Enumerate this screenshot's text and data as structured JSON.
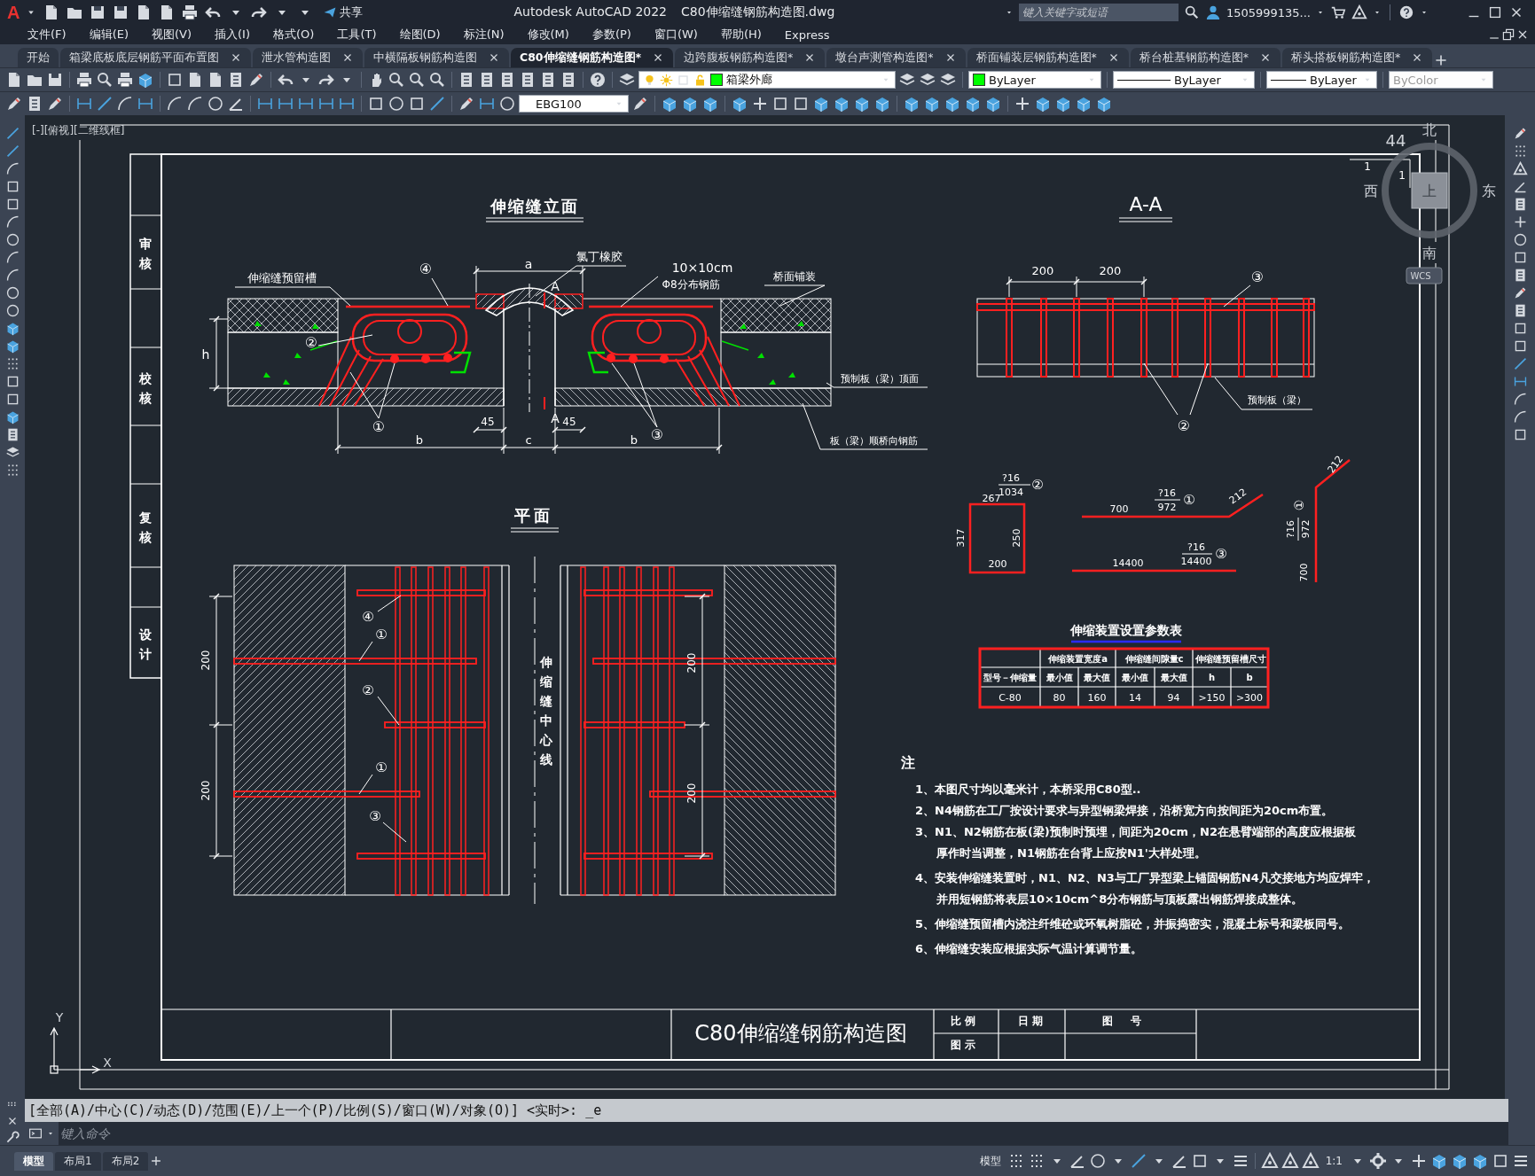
{
  "title_bar": {
    "logo": "A",
    "share": "共享",
    "app": "Autodesk AutoCAD 2022",
    "file": "C80伸缩缝钢筋构造图.dwg",
    "search": {
      "placeholder": "键入关键字或短语"
    },
    "user": "1505999135..."
  },
  "menu": [
    "文件(F)",
    "编辑(E)",
    "视图(V)",
    "插入(I)",
    "格式(O)",
    "工具(T)",
    "绘图(D)",
    "标注(N)",
    "修改(M)",
    "参数(P)",
    "窗口(W)",
    "帮助(H)",
    "Express"
  ],
  "file_tabs": [
    {
      "label": "开始",
      "selected": false,
      "closable": false
    },
    {
      "label": "箱梁底板底层钢筋平面布置图",
      "selected": false,
      "closable": true
    },
    {
      "label": "泄水管构造图",
      "selected": false,
      "closable": true
    },
    {
      "label": "中横隔板钢筋构造图",
      "selected": false,
      "closable": true
    },
    {
      "label": "C80伸缩缝钢筋构造图*",
      "selected": true,
      "closable": true
    },
    {
      "label": "边跨腹板钢筋构造图*",
      "selected": false,
      "closable": true
    },
    {
      "label": "墩台声测管构造图*",
      "selected": false,
      "closable": true
    },
    {
      "label": "桥面铺装层钢筋构造图*",
      "selected": false,
      "closable": true
    },
    {
      "label": "桥台桩基钢筋构造图*",
      "selected": false,
      "closable": true
    },
    {
      "label": "桥头搭板钢筋构造图*",
      "selected": false,
      "closable": true
    }
  ],
  "properties": {
    "layer": {
      "name": "箱梁外廊",
      "color": "#00ff00"
    },
    "color": {
      "value": "ByLayer",
      "color": "#00ff00"
    },
    "linetype": "ByLayer",
    "lineweight": "ByLayer",
    "plot_style": {
      "value": "ByColor",
      "disabled": true
    },
    "dim_style": "EBG100"
  },
  "viewport_label": "[-][俯视][二维线框]",
  "drawing": {
    "sign_labels": [
      "审核",
      "校核",
      "复核",
      "设计"
    ],
    "elevation": {
      "title": "伸缩缝立面",
      "labels": [
        "伸缩缝预留槽",
        "④",
        "a",
        "氯丁橡胶",
        "10×10cm",
        "Φ8分布钢筋",
        "桥面铺装",
        "A",
        "A",
        "h",
        "②",
        "①",
        "45",
        "45",
        "b",
        "c",
        "b",
        "③",
        "预制板（梁）顶面",
        "板（梁）顺桥向钢筋"
      ]
    },
    "section": {
      "title": "A-A",
      "labels": [
        "200",
        "200",
        "③",
        "②",
        "预制板（梁）"
      ]
    },
    "rebar_details": [
      {
        "labels": [
          "?16",
          "1034",
          "②",
          "267",
          "317",
          "250",
          "200"
        ]
      },
      {
        "labels": [
          "700",
          "?16",
          "972",
          "①",
          "212"
        ]
      },
      {
        "labels": [
          "14400",
          "?16",
          "14400",
          "③"
        ]
      },
      {
        "labels": [
          "212",
          "?16",
          "①",
          "972",
          "700"
        ]
      }
    ],
    "plan": {
      "title": "平面",
      "labels": [
        "④",
        "①",
        "②",
        "①",
        "③",
        "200",
        "200",
        "200",
        "200"
      ],
      "centerline": "伸缩缝中心线"
    },
    "table": {
      "title": "伸缩装置设置参数表",
      "header": [
        "型号－伸缩量",
        "伸缩装置宽度a",
        "伸缩缝间隙量c",
        "伸缩缝预留槽尺寸"
      ],
      "subheader": [
        "最小值",
        "最大值",
        "最小值",
        "最大值",
        "h",
        "b"
      ],
      "rows": [
        [
          "C-80",
          "80",
          "160",
          "14",
          "94",
          ">150",
          ">300"
        ]
      ]
    },
    "notes": {
      "heading": "注",
      "items": [
        {
          "lines": [
            "1、本图尺寸均以毫米计，本桥采用C80型.."
          ]
        },
        {
          "lines": [
            "2、N4钢筋在工厂按设计要求与异型钢梁焊接，沿桥宽方向按间距为20cm布置。"
          ]
        },
        {
          "lines": [
            "3、N1、N2钢筋在板(梁)预制时预埋，间距为20cm，N2在悬臂端部的高度应根据板",
            "厚作时当调整，N1钢筋在台背上应按N1'大样处理。"
          ]
        },
        {
          "lines": [
            "4、安装伸缩缝装置时，N1、N2、N3与工厂异型梁上锚固钢筋N4凡交接地方均应焊牢，",
            "并用短钢筋将表层10×10cm^8分布钢筋与顶板露出钢筋焊接成整体。"
          ]
        },
        {
          "lines": [
            "5、伸缩缝预留槽内浇注纤维砼或环氧树脂砼，并振捣密实，混凝土标号和梁板同号。"
          ]
        },
        {
          "lines": [
            "6、伸缩缝安装应根据实际气温计算调节量。"
          ]
        }
      ]
    },
    "title_block": {
      "title": "C80伸缩缝钢筋构造图",
      "scale": "比例",
      "date": "日期",
      "number": "图号",
      "legend": "图示"
    },
    "corner_labels": [
      "44",
      "1",
      "1"
    ],
    "viewcube": {
      "north": "北",
      "south": "南",
      "east": "东",
      "west": "西",
      "face": "上",
      "ucs": "WCS"
    },
    "ucs_icon": {
      "x": "X",
      "y": "Y"
    }
  },
  "command_line": {
    "history": "[全部(A)/中心(C)/动态(D)/范围(E)/上一个(P)/比例(S)/窗口(W)/对象(O)] <实时>: _e",
    "placeholder": "键入命令"
  },
  "layout_tabs": [
    {
      "label": "模型",
      "selected": true
    },
    {
      "label": "布局1",
      "selected": false
    },
    {
      "label": "布局2",
      "selected": false
    }
  ],
  "status_bar": {
    "space": "模型",
    "annotation_scale": "1:1"
  }
}
